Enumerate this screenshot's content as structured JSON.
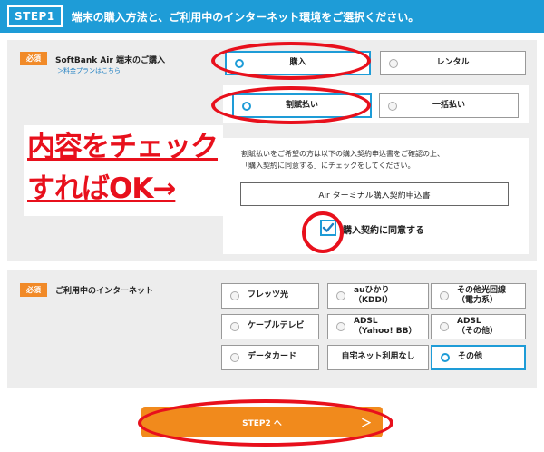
{
  "header": {
    "step_badge": "STEP1",
    "title": "端末の購入方法と、ご利用中のインターネット環境をご選択ください。"
  },
  "purchase": {
    "required_label": "必須",
    "section_label": "SoftBank Air 端末のご購入",
    "plan_link": "＞料金プランはこちら",
    "options": [
      {
        "label": "購入",
        "selected": true
      },
      {
        "label": "レンタル",
        "selected": false
      }
    ],
    "payment_options": [
      {
        "label": "割賦払い",
        "selected": true
      },
      {
        "label": "一括払い",
        "selected": false
      }
    ],
    "notice_line1": "割賦払いをご希望の方は以下の購入契約申込書をご確認の上、",
    "notice_line2": "「購入契約に同意する」にチェックをしてください。",
    "document_button": "Air ターミナル購入契約申込書",
    "agree_label": "購入契約に同意する",
    "agree_checked": true
  },
  "annotation": {
    "line1": "内容をチェック",
    "line2": "すればOK→"
  },
  "internet": {
    "required_label": "必須",
    "section_label": "ご利用中のインターネット",
    "options": [
      {
        "line1": "フレッツ光",
        "line2": "",
        "selected": false
      },
      {
        "line1": "auひかり",
        "line2": "（KDDI）",
        "selected": false
      },
      {
        "line1": "その他光回線",
        "line2": "（電力系）",
        "selected": false
      },
      {
        "line1": "ケーブルテレビ",
        "line2": "",
        "selected": false
      },
      {
        "line1": "ADSL",
        "line2": "（Yahoo! BB）",
        "selected": false
      },
      {
        "line1": "ADSL",
        "line2": "（その他）",
        "selected": false
      },
      {
        "line1": "データカード",
        "line2": "",
        "selected": false
      },
      {
        "line1": "自宅ネット利用なし",
        "line2": "",
        "selected": false
      },
      {
        "line1": "その他",
        "line2": "",
        "selected": true
      }
    ]
  },
  "next_button": {
    "label": "STEP2 へ",
    "chevron": "＞"
  },
  "colors": {
    "accent": "#1e9cd7",
    "orange": "#f18a1c",
    "highlight_red": "#e8101c",
    "section_bg": "#ededed"
  }
}
